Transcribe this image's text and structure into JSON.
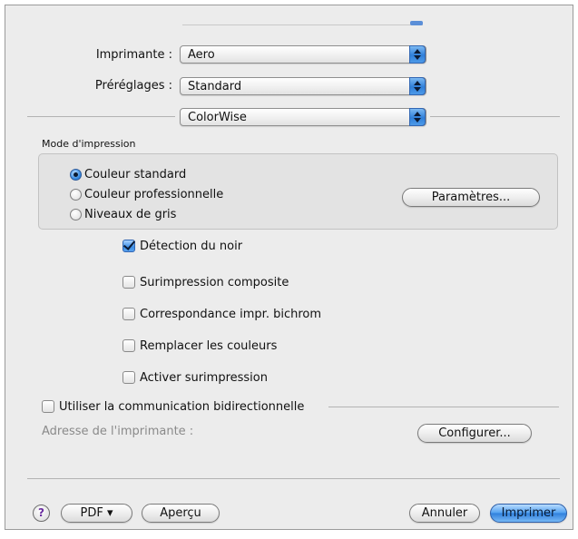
{
  "printer": {
    "label": "Imprimante :",
    "value": "Aero"
  },
  "presets": {
    "label": "Préréglages :",
    "value": "Standard"
  },
  "panel": {
    "value": "ColorWise"
  },
  "print_mode": {
    "title": "Mode d'impression",
    "options": [
      {
        "label": "Couleur standard",
        "selected": true
      },
      {
        "label": "Couleur professionnelle",
        "selected": false
      },
      {
        "label": "Niveaux de gris",
        "selected": false
      }
    ],
    "settings_button": "Paramètres..."
  },
  "options": [
    {
      "label": "Détection du noir",
      "checked": true
    },
    {
      "label": "Surimpression composite",
      "checked": false
    },
    {
      "label": "Correspondance impr. bichrom",
      "checked": false
    },
    {
      "label": "Remplacer les couleurs",
      "checked": false
    },
    {
      "label": "Activer surimpression",
      "checked": false
    }
  ],
  "bidirectional": {
    "label": "Utiliser la communication bidirectionnelle",
    "checked": false,
    "address_label": "Adresse de l'imprimante :",
    "configure_button": "Configurer..."
  },
  "footer": {
    "help_glyph": "?",
    "pdf_button": "PDF ▾",
    "preview_button": "Aperçu",
    "cancel_button": "Annuler",
    "print_button": "Imprimer"
  },
  "colors": {
    "accent": "#3b8de3",
    "dialog_bg": "#ececec"
  }
}
